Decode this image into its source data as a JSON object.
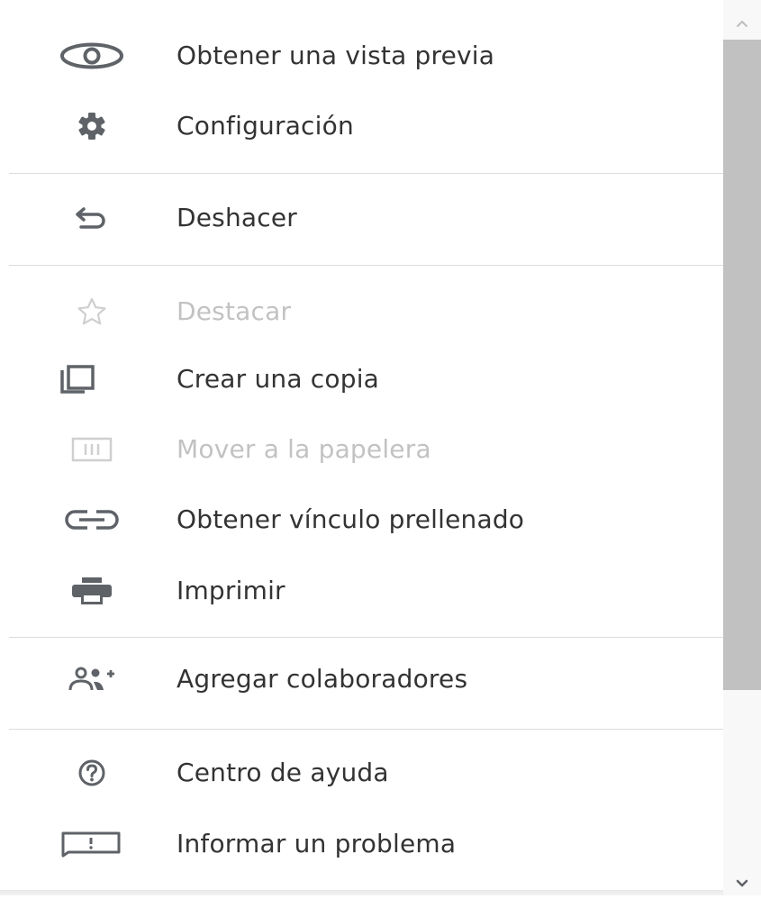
{
  "menu": {
    "items": [
      {
        "label": "Obtener una vista previa",
        "icon": "eye-icon",
        "disabled": false
      },
      {
        "label": "Configuración",
        "icon": "gear-icon",
        "disabled": false
      },
      {
        "label": "Deshacer",
        "icon": "undo-icon",
        "disabled": false
      },
      {
        "label": "Destacar",
        "icon": "star-outline-icon",
        "disabled": true
      },
      {
        "label": "Crear una copia",
        "icon": "copy-icon",
        "disabled": false
      },
      {
        "label": "Mover a la papelera",
        "icon": "trash-icon",
        "disabled": true
      },
      {
        "label": "Obtener vínculo prellenado",
        "icon": "link-icon",
        "disabled": false
      },
      {
        "label": "Imprimir",
        "icon": "printer-icon",
        "disabled": false
      },
      {
        "label": "Agregar colaboradores",
        "icon": "add-people-icon",
        "disabled": false
      },
      {
        "label": "Centro de ayuda",
        "icon": "help-circle-icon",
        "disabled": false
      },
      {
        "label": "Informar un problema",
        "icon": "feedback-icon",
        "disabled": false
      }
    ]
  },
  "colors": {
    "text": "#333333",
    "text_disabled": "#c2c2c2",
    "icon": "#5f6368",
    "icon_disabled": "#cfcfcf",
    "divider": "#dcdcdc",
    "scroll_thumb": "#c1c1c1",
    "scroll_track": "#f8f8f8"
  }
}
